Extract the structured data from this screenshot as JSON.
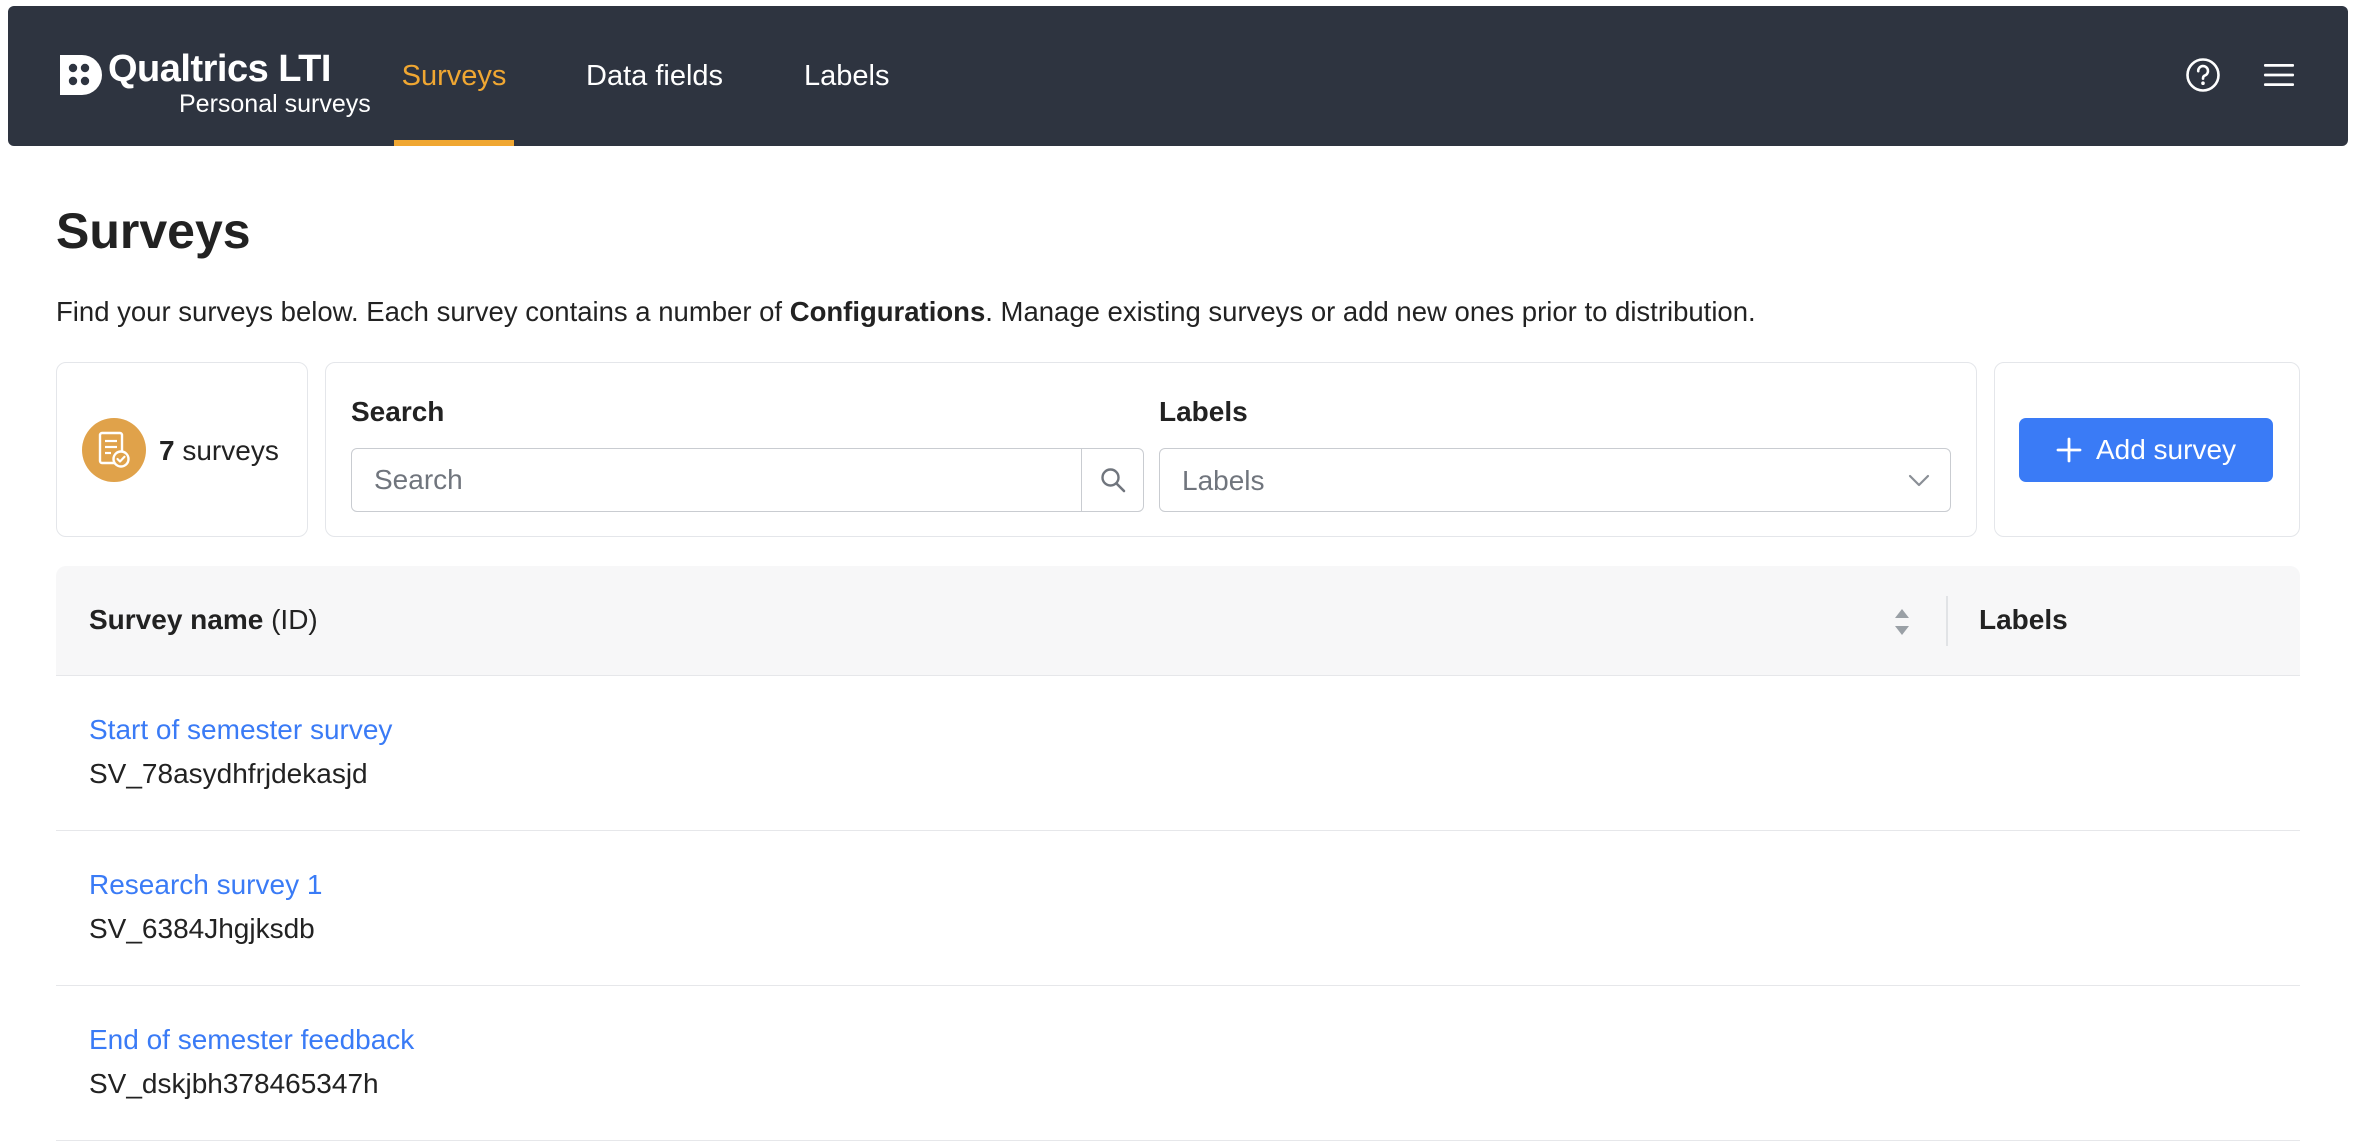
{
  "brand": {
    "name": "Qualtrics LTI",
    "subtitle": "Personal surveys",
    "icon": "qualtrics-logo"
  },
  "nav": {
    "tabs": [
      {
        "label": "Surveys",
        "active": true
      },
      {
        "label": "Data fields",
        "active": false
      },
      {
        "label": "Labels",
        "active": false
      }
    ],
    "icons": [
      "help-icon",
      "menu-icon"
    ],
    "accent_color": "#f0a732",
    "background_color": "#2e3440"
  },
  "page": {
    "title": "Surveys",
    "description_before": "Find your surveys below. Each survey contains a number of ",
    "description_bold": "Configurations",
    "description_after": ". Manage existing surveys or add new ones prior to distribution."
  },
  "summary": {
    "count": "7",
    "unit": "surveys",
    "icon": "survey-check-icon",
    "badge_color": "#e0a24a"
  },
  "filters": {
    "search_label": "Search",
    "search_placeholder": "Search",
    "search_value": "",
    "labels_label": "Labels",
    "labels_placeholder": "Labels"
  },
  "actions": {
    "add_survey_label": "Add survey",
    "button_color": "#3a7bf6"
  },
  "table": {
    "columns": {
      "name_bold": "Survey name",
      "name_suffix": " (ID)",
      "labels": "Labels"
    },
    "rows": [
      {
        "name": "Start of semester survey",
        "id": "SV_78asydhfrjdekasjd",
        "labels": ""
      },
      {
        "name": "Research survey 1",
        "id": "SV_6384Jhgjksdb",
        "labels": ""
      },
      {
        "name": "End of semester feedback",
        "id": "SV_dskjbh378465347h",
        "labels": ""
      }
    ]
  }
}
